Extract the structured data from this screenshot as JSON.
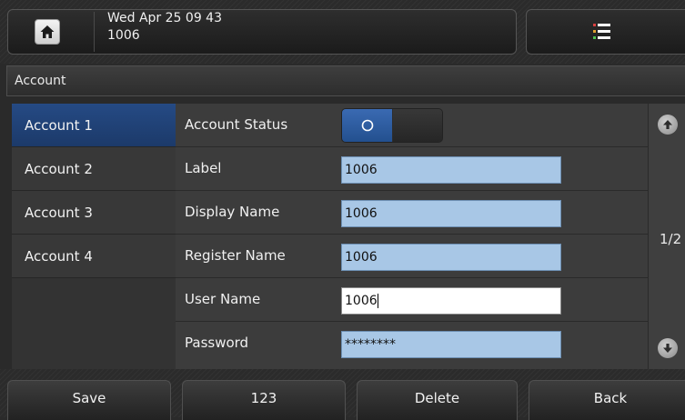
{
  "status_bar": {
    "date_time": "Wed Apr 25 09 43",
    "extension": "1006",
    "home_icon": "home-icon",
    "menu_icon": "menu-list-icon"
  },
  "header": {
    "title": "Account"
  },
  "accounts": [
    {
      "label": "Account 1",
      "selected": true
    },
    {
      "label": "Account 2",
      "selected": false
    },
    {
      "label": "Account 3",
      "selected": false
    },
    {
      "label": "Account 4",
      "selected": false
    }
  ],
  "form": {
    "account_status": {
      "label": "Account Status",
      "state": "on",
      "knob_glyph": "O"
    },
    "label_field": {
      "label": "Label",
      "value": "1006"
    },
    "display_name": {
      "label": "Display Name",
      "value": "1006"
    },
    "register_name": {
      "label": "Register Name",
      "value": "1006"
    },
    "user_name": {
      "label": "User Name",
      "value": "1006"
    },
    "password": {
      "label": "Password",
      "value": "********"
    }
  },
  "scroller": {
    "page_indicator": "1/2",
    "up_icon": "arrow-up-icon",
    "down_icon": "arrow-down-icon"
  },
  "softkeys": {
    "save": "Save",
    "input_mode": "123",
    "delete": "Delete",
    "back": "Back"
  },
  "colors": {
    "selected_account": "#254a84",
    "field_background": "#a8c7e6",
    "focused_field": "#ffffff",
    "toggle_on": "#23508f"
  }
}
